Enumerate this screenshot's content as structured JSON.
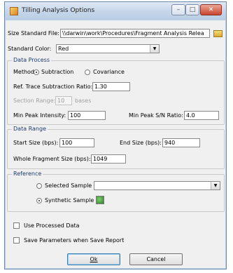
{
  "window": {
    "title": "Tilling Analysis Options",
    "min": "–",
    "max": "□",
    "close": "✕"
  },
  "size_standard": {
    "label": "Size Standard File:",
    "value": "\\\\darwin\\work\\Procedures\\Fragment Analysis Relea"
  },
  "standard_color": {
    "label": "Standard Color:",
    "value": "Red"
  },
  "data_process": {
    "legend": "Data Process",
    "method_label": "Method:",
    "method_subtraction": "Subtraction",
    "method_covariance": "Covariance",
    "ref_trace_label": "Ref. Trace Subtraction Ratio:",
    "ref_trace_value": "1.30",
    "section_range_label": "Section Range:",
    "section_range_value": "10",
    "section_range_unit": "bases",
    "min_peak_label": "Min Peak Intensity:",
    "min_peak_value": "100",
    "min_sn_label": "Min Peak S/N Ratio:",
    "min_sn_value": "4.0"
  },
  "data_range": {
    "legend": "Data Range",
    "start_label": "Start Size (bps):",
    "start_value": "100",
    "end_label": "End Size (bps):",
    "end_value": "940",
    "whole_label": "Whole Fragment Size (bps):",
    "whole_value": "1049"
  },
  "reference": {
    "legend": "Reference",
    "selected_label": "Selected Sample",
    "selected_value": "",
    "synthetic_label": "Synthetic Sample"
  },
  "options": {
    "use_processed": "Use Processed Data",
    "save_params": "Save Parameters when Save Report"
  },
  "buttons": {
    "ok": "Ok",
    "cancel": "Cancel"
  }
}
